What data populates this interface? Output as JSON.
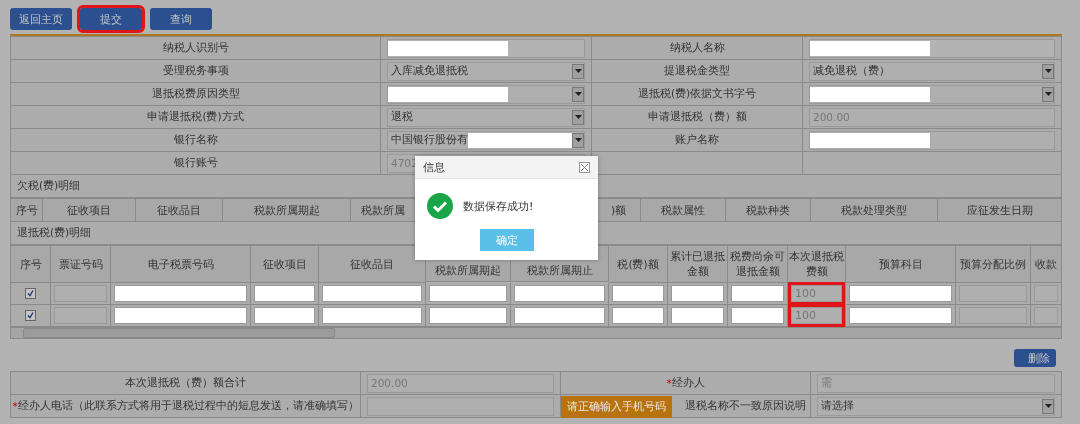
{
  "toolbar": {
    "buttons": [
      {
        "label": "返回主页",
        "highlighted": false
      },
      {
        "label": "提交",
        "highlighted": true
      },
      {
        "label": "查询",
        "highlighted": false
      }
    ]
  },
  "form": {
    "rows": [
      {
        "cells": [
          {
            "label": "纳税人识别号",
            "field": {
              "kind": "input",
              "redacted": true
            }
          },
          {
            "label": "纳税人名称",
            "field": {
              "kind": "input",
              "redacted": true
            }
          }
        ]
      },
      {
        "cells": [
          {
            "label": "受理税务事项",
            "field": {
              "kind": "select",
              "value": "入库减免退抵税"
            }
          },
          {
            "label": "提退税金类型",
            "field": {
              "kind": "select",
              "value": "减免退税（费）"
            }
          }
        ]
      },
      {
        "cells": [
          {
            "label": "退抵税费原因类型",
            "field": {
              "kind": "select",
              "redacted": true
            }
          },
          {
            "label": "退抵税(费)依据文书字号",
            "field": {
              "kind": "select",
              "redacted": true
            }
          }
        ]
      },
      {
        "cells": [
          {
            "label": "申请退抵税(费)方式",
            "field": {
              "kind": "select",
              "value": "退税"
            }
          },
          {
            "label": "申请退抵税（费）额",
            "field": {
              "kind": "readonly",
              "value": "200.00"
            }
          }
        ]
      },
      {
        "cells": [
          {
            "label": "银行名称",
            "field": {
              "kind": "select",
              "value": "中国银行股份有",
              "redacted": true
            }
          },
          {
            "label": "账户名称",
            "field": {
              "kind": "readonly",
              "redacted": true
            }
          }
        ]
      },
      {
        "cells": [
          {
            "label": "银行账号",
            "field": {
              "kind": "readonly",
              "value": "4702"
            }
          }
        ]
      }
    ]
  },
  "arrears": {
    "title": "欠税(费)明细",
    "columns": [
      "序号",
      "征收项目",
      "征收品目",
      "税款所属期起",
      "税款所属",
      ")额",
      "税款属性",
      "税款种类",
      "税款处理类型",
      "应征发生日期"
    ]
  },
  "refunds": {
    "title": "退抵税(费)明细",
    "columns": [
      "序号",
      "票证号码",
      "电子税票号码",
      "征收项目",
      "征收品目",
      "税款所属期起",
      "税款所属期止",
      "税(费)额",
      "累计已退抵金额",
      "税费尚余可退抵金额",
      "本次退抵税费额",
      "预算科目",
      "预算分配比例",
      "收款"
    ],
    "rows": [
      {
        "checked": true,
        "amount": "100",
        "highlighted": true
      },
      {
        "checked": true,
        "amount": "100",
        "highlighted": true
      }
    ]
  },
  "delete_button": "删除",
  "summary": {
    "rows": [
      {
        "cells": [
          {
            "label": "本次退抵税（费）额合计",
            "field": {
              "kind": "readonly",
              "value": "200.00"
            }
          },
          {
            "label": "经办人",
            "required_mark": "*",
            "field": {
              "kind": "readonly",
              "value": "需"
            }
          }
        ]
      },
      {
        "cells": [
          {
            "label": "经办人电话（此联系方式将用于退税过程中的短息发送，请准确填写）",
            "required_mark": "*",
            "field": {
              "kind": "readonly"
            }
          },
          {
            "label": "退税名称不一致原因说明",
            "tooltip": "请正确输入手机号码",
            "field": {
              "kind": "select",
              "value": "请选择"
            }
          }
        ]
      }
    ]
  },
  "dialog": {
    "title": "信息",
    "message": "数据保存成功!",
    "button": "确定"
  }
}
